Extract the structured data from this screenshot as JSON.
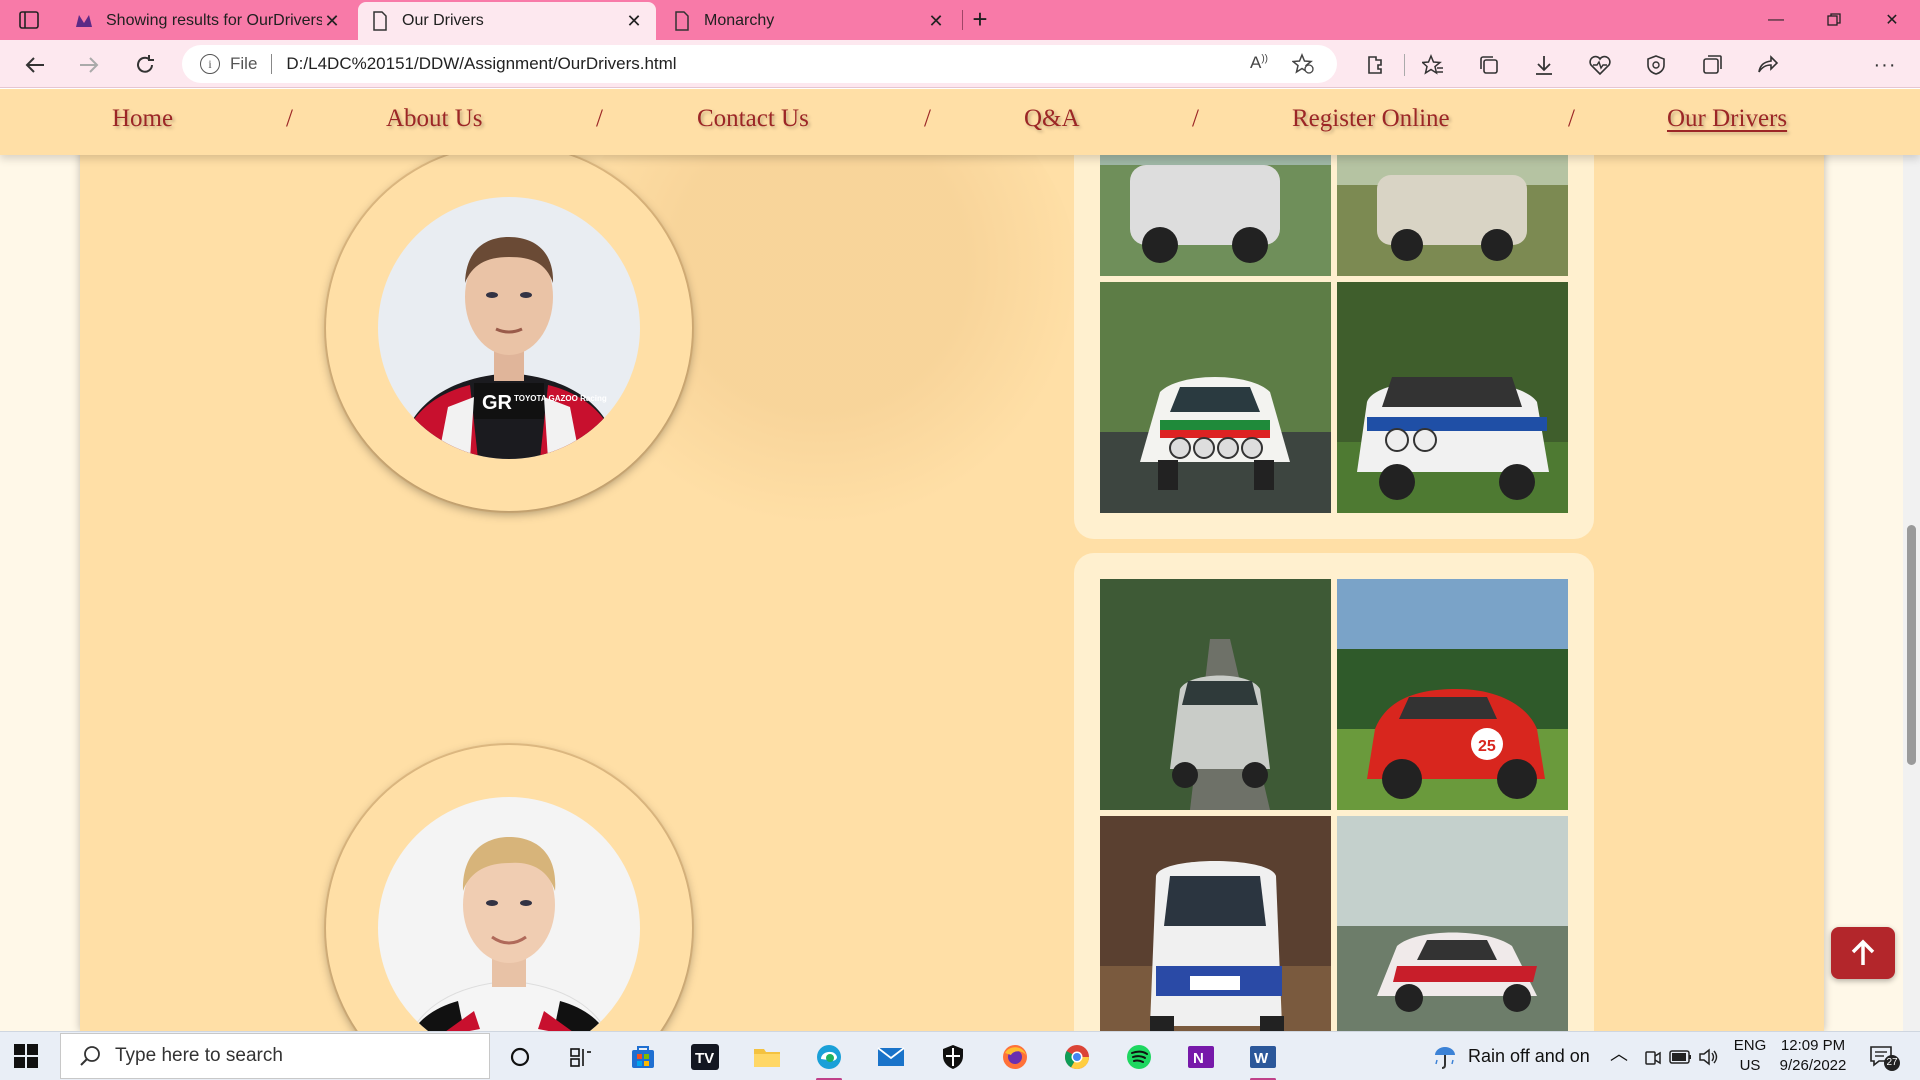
{
  "browser": {
    "tabs": [
      {
        "title": "Showing results for OurDrivers.h",
        "favicon": "monarchy-logo-icon",
        "active": false
      },
      {
        "title": "Our Drivers",
        "favicon": "page-icon",
        "active": true
      },
      {
        "title": "Monarchy",
        "favicon": "page-icon",
        "active": false
      }
    ],
    "address": {
      "scheme_label": "File",
      "url": "D:/L4DC%20151/DDW/Assignment/OurDrivers.html"
    },
    "toolbar_icons": [
      "read-aloud-icon",
      "add-favorite-icon",
      "extensions-icon",
      "favorites-icon",
      "collections-icon",
      "downloads-icon",
      "browser-essentials-icon",
      "security-icon",
      "screenshot-icon",
      "share-icon",
      "profile-avatar",
      "more-icon"
    ]
  },
  "site": {
    "nav": {
      "items": [
        "Home",
        "About Us",
        "Contact Us",
        "Q&A",
        "Register Online",
        "Our Drivers"
      ],
      "separator": "/",
      "current": "Our Drivers"
    },
    "drivers": [
      {
        "portrait": "driver-1-portrait",
        "suit_text": "TOYOTA GAZOO Racing",
        "gallery": [
          "classic-rally-car-1",
          "classic-rally-car-2",
          "lancia-stratos-alitalia",
          "bmw-2002-rally"
        ]
      },
      {
        "portrait": "driver-2-portrait",
        "gallery": [
          "renault-4-forest-road",
          "red-coupe-number-25",
          "white-rally-hatchback",
          "lancia-stratos-red-white"
        ]
      }
    ],
    "back_to_top": "↑"
  },
  "taskbar": {
    "search_placeholder": "Type here to search",
    "weather": "Rain off and on",
    "language": "ENG",
    "region": "US",
    "time": "12:09 PM",
    "date": "9/26/2022",
    "notifications": "27"
  },
  "colors": {
    "tab_strip": "#f87aa8",
    "page_bg": "#ffdfa6",
    "nav_link": "#9c2626",
    "button": "#b3262b"
  }
}
